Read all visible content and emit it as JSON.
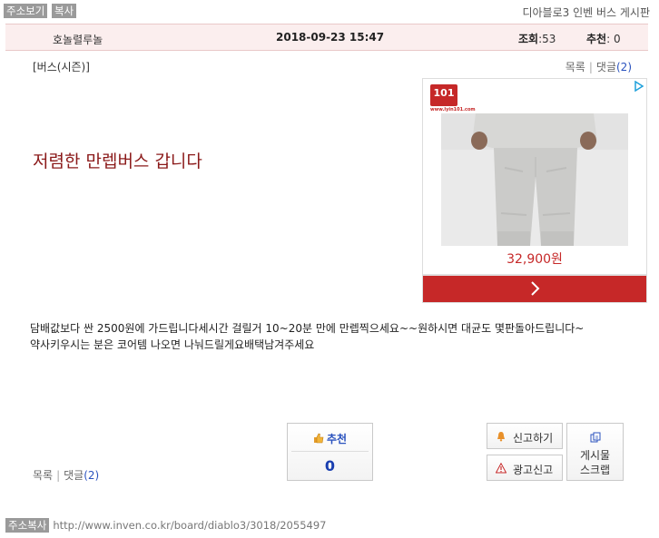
{
  "topbar": {
    "view_address": "주소보기",
    "copy": "복사",
    "board_title": "디아블로3 인벤 버스 게시판"
  },
  "info": {
    "author": "호놀렬루놀",
    "date": "2018-09-23 15:47",
    "views_label": "조회",
    "views_value": ":53",
    "reco_label": "추천",
    "reco_value": ": 0"
  },
  "post": {
    "category": "[버스(시즌)]",
    "title": "저렴한 만렙버스 갑니다",
    "body_lines": [
      "담배값보다 싼 2500원에 가드립니다세시간 걸릴거 10~20분 만에 만렙찍으세요~~원하시면 대균도 몇판돌아드립니다~",
      "약사키우시는 분은 코어템 나오면 나눠드릴게요배택남겨주세요"
    ]
  },
  "links": {
    "list": "목록",
    "sep": "|",
    "comments": "댓글",
    "comment_count_text": "(2)"
  },
  "ad": {
    "logo": "101",
    "logo_sub": "www.lyin101.com",
    "choice_icon": "ad-choices-icon",
    "price": "32,900원"
  },
  "buttons": {
    "recommend_label": "추천",
    "recommend_count": "0",
    "report": "신고하기",
    "ad_report": "광고신고",
    "scrap_line1": "게시물",
    "scrap_line2": "스크랩"
  },
  "footer": {
    "address_copy": "주소복사",
    "url": "http://www.inven.co.kr/board/diablo3/3018/2055497"
  },
  "colors": {
    "accent_red": "#c62828",
    "title_color": "#8b1a1a",
    "link_blue": "#2a52be",
    "info_bg": "#fbeeee"
  }
}
